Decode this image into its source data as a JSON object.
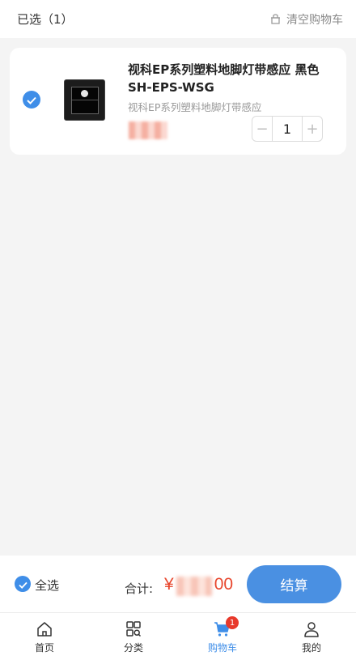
{
  "header": {
    "selected_label": "已选（1）",
    "clear_label": "清空购物车"
  },
  "cart": {
    "items": [
      {
        "title": "视科EP系列塑料地脚灯带感应 黑色 SH-EPS-WSG",
        "subtitle": "视科EP系列塑料地脚灯带感应",
        "quantity": "1",
        "checked": true
      }
    ]
  },
  "stepper": {
    "minus_symbol": "−",
    "plus_symbol": "+"
  },
  "checkout": {
    "select_all_label": "全选",
    "total_label": "合计:",
    "total_currency": "¥",
    "total_value_visible": "00",
    "pay_label": "结算"
  },
  "tabbar": {
    "tabs": [
      {
        "label": "首页",
        "icon": "home-icon"
      },
      {
        "label": "分类",
        "icon": "category-icon"
      },
      {
        "label": "购物车",
        "icon": "cart-icon",
        "badge": "1",
        "active": true
      },
      {
        "label": "我的",
        "icon": "user-icon"
      }
    ]
  },
  "colors": {
    "accent": "#3f8ee8",
    "price": "#e8462d",
    "badge": "#e8392b"
  }
}
